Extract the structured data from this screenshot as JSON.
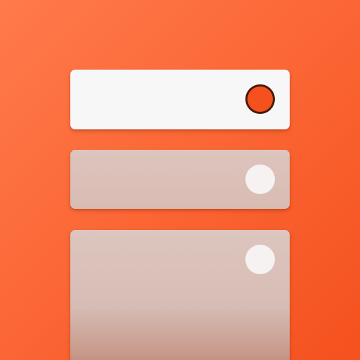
{
  "icon": {
    "name": "stacked-toggle-cards-icon",
    "colors": {
      "background_start": "#ff7a4c",
      "background_end": "#f4511e",
      "card_active": "#f7f7f7",
      "card_inactive": "#d8bcb3",
      "knob_active_fill": "#f4511e",
      "knob_active_ring": "#4a1a0c",
      "knob_inactive": "#f5f2f1"
    },
    "cards": [
      {
        "state": "active"
      },
      {
        "state": "inactive"
      },
      {
        "state": "inactive"
      }
    ]
  }
}
